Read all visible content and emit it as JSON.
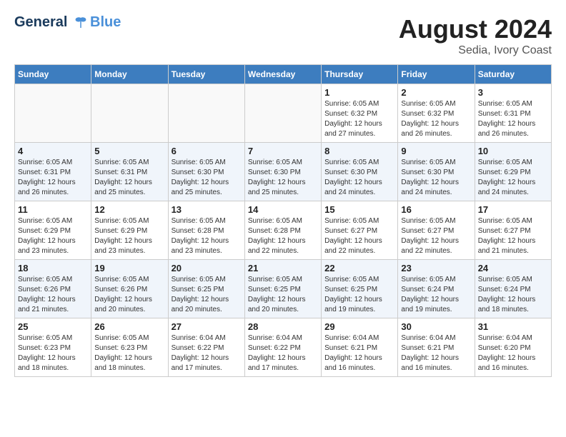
{
  "header": {
    "logo_line1": "General",
    "logo_line2": "Blue",
    "month_year": "August 2024",
    "location": "Sedia, Ivory Coast"
  },
  "weekdays": [
    "Sunday",
    "Monday",
    "Tuesday",
    "Wednesday",
    "Thursday",
    "Friday",
    "Saturday"
  ],
  "weeks": [
    [
      {
        "day": "",
        "info": ""
      },
      {
        "day": "",
        "info": ""
      },
      {
        "day": "",
        "info": ""
      },
      {
        "day": "",
        "info": ""
      },
      {
        "day": "1",
        "info": "Sunrise: 6:05 AM\nSunset: 6:32 PM\nDaylight: 12 hours\nand 27 minutes."
      },
      {
        "day": "2",
        "info": "Sunrise: 6:05 AM\nSunset: 6:32 PM\nDaylight: 12 hours\nand 26 minutes."
      },
      {
        "day": "3",
        "info": "Sunrise: 6:05 AM\nSunset: 6:31 PM\nDaylight: 12 hours\nand 26 minutes."
      }
    ],
    [
      {
        "day": "4",
        "info": "Sunrise: 6:05 AM\nSunset: 6:31 PM\nDaylight: 12 hours\nand 26 minutes."
      },
      {
        "day": "5",
        "info": "Sunrise: 6:05 AM\nSunset: 6:31 PM\nDaylight: 12 hours\nand 25 minutes."
      },
      {
        "day": "6",
        "info": "Sunrise: 6:05 AM\nSunset: 6:30 PM\nDaylight: 12 hours\nand 25 minutes."
      },
      {
        "day": "7",
        "info": "Sunrise: 6:05 AM\nSunset: 6:30 PM\nDaylight: 12 hours\nand 25 minutes."
      },
      {
        "day": "8",
        "info": "Sunrise: 6:05 AM\nSunset: 6:30 PM\nDaylight: 12 hours\nand 24 minutes."
      },
      {
        "day": "9",
        "info": "Sunrise: 6:05 AM\nSunset: 6:30 PM\nDaylight: 12 hours\nand 24 minutes."
      },
      {
        "day": "10",
        "info": "Sunrise: 6:05 AM\nSunset: 6:29 PM\nDaylight: 12 hours\nand 24 minutes."
      }
    ],
    [
      {
        "day": "11",
        "info": "Sunrise: 6:05 AM\nSunset: 6:29 PM\nDaylight: 12 hours\nand 23 minutes."
      },
      {
        "day": "12",
        "info": "Sunrise: 6:05 AM\nSunset: 6:29 PM\nDaylight: 12 hours\nand 23 minutes."
      },
      {
        "day": "13",
        "info": "Sunrise: 6:05 AM\nSunset: 6:28 PM\nDaylight: 12 hours\nand 23 minutes."
      },
      {
        "day": "14",
        "info": "Sunrise: 6:05 AM\nSunset: 6:28 PM\nDaylight: 12 hours\nand 22 minutes."
      },
      {
        "day": "15",
        "info": "Sunrise: 6:05 AM\nSunset: 6:27 PM\nDaylight: 12 hours\nand 22 minutes."
      },
      {
        "day": "16",
        "info": "Sunrise: 6:05 AM\nSunset: 6:27 PM\nDaylight: 12 hours\nand 22 minutes."
      },
      {
        "day": "17",
        "info": "Sunrise: 6:05 AM\nSunset: 6:27 PM\nDaylight: 12 hours\nand 21 minutes."
      }
    ],
    [
      {
        "day": "18",
        "info": "Sunrise: 6:05 AM\nSunset: 6:26 PM\nDaylight: 12 hours\nand 21 minutes."
      },
      {
        "day": "19",
        "info": "Sunrise: 6:05 AM\nSunset: 6:26 PM\nDaylight: 12 hours\nand 20 minutes."
      },
      {
        "day": "20",
        "info": "Sunrise: 6:05 AM\nSunset: 6:25 PM\nDaylight: 12 hours\nand 20 minutes."
      },
      {
        "day": "21",
        "info": "Sunrise: 6:05 AM\nSunset: 6:25 PM\nDaylight: 12 hours\nand 20 minutes."
      },
      {
        "day": "22",
        "info": "Sunrise: 6:05 AM\nSunset: 6:25 PM\nDaylight: 12 hours\nand 19 minutes."
      },
      {
        "day": "23",
        "info": "Sunrise: 6:05 AM\nSunset: 6:24 PM\nDaylight: 12 hours\nand 19 minutes."
      },
      {
        "day": "24",
        "info": "Sunrise: 6:05 AM\nSunset: 6:24 PM\nDaylight: 12 hours\nand 18 minutes."
      }
    ],
    [
      {
        "day": "25",
        "info": "Sunrise: 6:05 AM\nSunset: 6:23 PM\nDaylight: 12 hours\nand 18 minutes."
      },
      {
        "day": "26",
        "info": "Sunrise: 6:05 AM\nSunset: 6:23 PM\nDaylight: 12 hours\nand 18 minutes."
      },
      {
        "day": "27",
        "info": "Sunrise: 6:04 AM\nSunset: 6:22 PM\nDaylight: 12 hours\nand 17 minutes."
      },
      {
        "day": "28",
        "info": "Sunrise: 6:04 AM\nSunset: 6:22 PM\nDaylight: 12 hours\nand 17 minutes."
      },
      {
        "day": "29",
        "info": "Sunrise: 6:04 AM\nSunset: 6:21 PM\nDaylight: 12 hours\nand 16 minutes."
      },
      {
        "day": "30",
        "info": "Sunrise: 6:04 AM\nSunset: 6:21 PM\nDaylight: 12 hours\nand 16 minutes."
      },
      {
        "day": "31",
        "info": "Sunrise: 6:04 AM\nSunset: 6:20 PM\nDaylight: 12 hours\nand 16 minutes."
      }
    ]
  ]
}
